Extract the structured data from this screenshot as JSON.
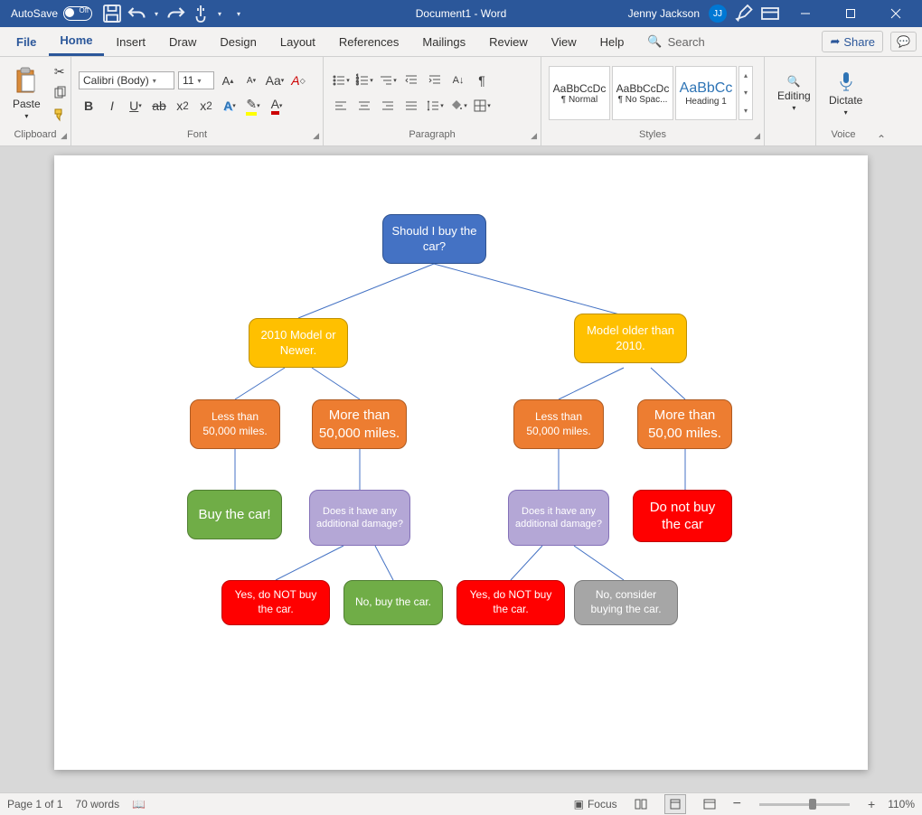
{
  "title": "Document1 - Word",
  "autosave_label": "AutoSave",
  "autosave_state": "Off",
  "user": {
    "name": "Jenny Jackson",
    "initials": "JJ"
  },
  "tabs": [
    "File",
    "Home",
    "Insert",
    "Draw",
    "Design",
    "Layout",
    "References",
    "Mailings",
    "Review",
    "View",
    "Help"
  ],
  "search_label": "Search",
  "share_label": "Share",
  "font": {
    "name": "Calibri (Body)",
    "size": "11"
  },
  "groups": {
    "clipboard": "Clipboard",
    "font": "Font",
    "paragraph": "Paragraph",
    "styles": "Styles",
    "voice": "Voice"
  },
  "paste_label": "Paste",
  "editing_label": "Editing",
  "dictate_label": "Dictate",
  "styles": [
    {
      "preview": "AaBbCcDc",
      "name": "¶ Normal"
    },
    {
      "preview": "AaBbCcDc",
      "name": "¶ No Spac..."
    },
    {
      "preview": "AaBbCc",
      "name": "Heading 1"
    }
  ],
  "status": {
    "page": "Page 1 of 1",
    "words": "70 words",
    "focus": "Focus",
    "zoom": "110%"
  },
  "chart_data": {
    "type": "tree-flowchart",
    "nodes": {
      "root": "Should I buy the car?",
      "l1a": "2010 Model or Newer.",
      "l1b": "Model older than 2010.",
      "l2a": "Less than 50,000 miles.",
      "l2b": "More than 50,000 miles.",
      "l2c": "Less than 50,000 miles.",
      "l2d": "More than 50,00 miles.",
      "l3a": "Buy the car!",
      "l3b": "Does it have any additional damage?",
      "l3c": "Does it have any additional damage?",
      "l3d": "Do not buy the car",
      "l4a": "Yes, do NOT buy the car.",
      "l4b": "No, buy the car.",
      "l4c": "Yes, do NOT buy the car.",
      "l4d": "No, consider buying the car."
    }
  }
}
